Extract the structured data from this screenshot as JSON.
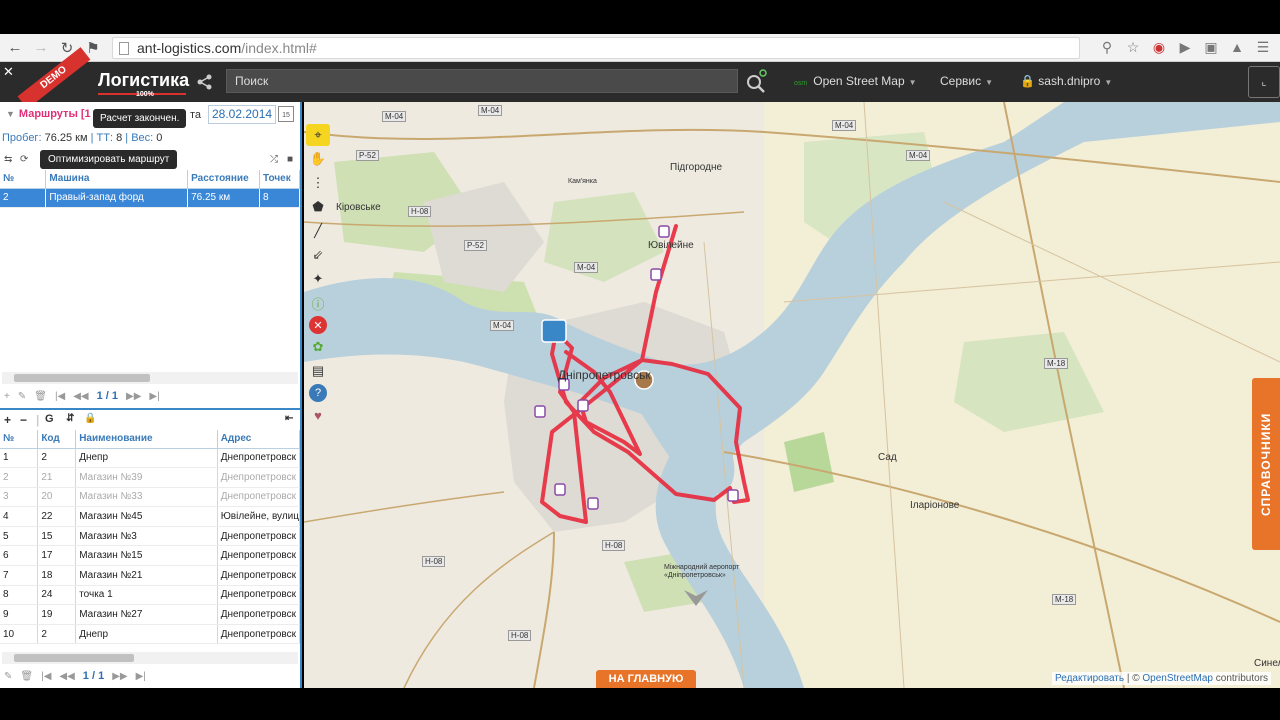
{
  "browser": {
    "url_host": "ant-logistics.com",
    "url_path": "/index.html#"
  },
  "header": {
    "demo_badge": "DEMO",
    "app_title": "Логистика",
    "progress_label": "100%",
    "search_placeholder": "Поиск",
    "map_provider": "Open Street Map",
    "map_provider_tag": "osm",
    "service_menu": "Сервис",
    "user_name": "sash.dnipro"
  },
  "routes_panel": {
    "tab_label": "Маршруты [1",
    "date_label": "та",
    "date_value": "28.02.2014",
    "tooltip_calc": "Расчет закончен.",
    "mileage_label": "Пробег:",
    "mileage_value": "76.25 км",
    "tt_label": "ТТ:",
    "tt_value": "8",
    "weight_label": "Вес:",
    "weight_value": "0",
    "tooltip_optimize": "Оптимизировать маршрут",
    "columns": [
      "№",
      "Машина",
      "Расстояние",
      "Точек"
    ],
    "rows": [
      {
        "no": "2",
        "car": "Правый-запад форд",
        "distance": "76.25 км",
        "points": "8"
      }
    ],
    "pager": "1 / 1"
  },
  "points_panel": {
    "toolbar_g": "G",
    "columns": [
      "№",
      "Код",
      "Наименование",
      "Адрес"
    ],
    "rows": [
      {
        "no": "1",
        "code": "2",
        "name": "Днепр",
        "address": "Днепропетровск",
        "muted": false
      },
      {
        "no": "2",
        "code": "21",
        "name": "Магазин №39",
        "address": "Днепропетровск",
        "muted": true
      },
      {
        "no": "3",
        "code": "20",
        "name": "Магазин №33",
        "address": "Днепропетровск",
        "muted": true
      },
      {
        "no": "4",
        "code": "22",
        "name": "Магазин №45",
        "address": "Ювілейне, вулиц",
        "muted": false
      },
      {
        "no": "5",
        "code": "15",
        "name": "Магазин №3",
        "address": "Днепропетровск",
        "muted": false
      },
      {
        "no": "6",
        "code": "17",
        "name": "Магазин №15",
        "address": "Днепропетровск",
        "muted": false
      },
      {
        "no": "7",
        "code": "18",
        "name": "Магазин №21",
        "address": "Днепропетровск",
        "muted": false
      },
      {
        "no": "8",
        "code": "24",
        "name": "точка 1",
        "address": "Днепропетровск",
        "muted": false
      },
      {
        "no": "9",
        "code": "19",
        "name": "Магазин №27",
        "address": "Днепропетровск",
        "muted": false
      },
      {
        "no": "10",
        "code": "2",
        "name": "Днепр",
        "address": "Днепропетровск",
        "muted": false
      }
    ],
    "pager": "1 / 1"
  },
  "map": {
    "labels": {
      "pidgorodne": "Підгородне",
      "kirovske": "Кіровське",
      "yuvileine": "Ювілейне",
      "dnipro": "Дніпропетровськ",
      "sad": "Сад",
      "ilarionove": "Іларіонове",
      "synelnyk": "Синель",
      "kamyanka": "Кам'янка",
      "airport": "Міжнародний аеропорт «Дніпропетровськ»"
    },
    "roads": [
      "M-04",
      "M-04",
      "M-04",
      "P-52",
      "P-52",
      "M-04",
      "M-04",
      "M-04",
      "M-18",
      "H-08",
      "H-08",
      "H-08",
      "M-18",
      "H-08"
    ],
    "sprav_tab": "СПРАВОЧНИКИ",
    "home_button": "НА ГЛАВНУЮ",
    "attribution_edit": "Редактировать",
    "attribution_sep": " | © ",
    "attribution_osm": "OpenStreetMap",
    "attribution_contrib": " contributors",
    "route_color": "#e8283c",
    "icons": [
      "locate-icon",
      "hand-icon",
      "points-icon",
      "polygon-icon",
      "line-icon",
      "arrow-icon",
      "magic-icon",
      "info-icon",
      "delete-icon",
      "leaf-icon",
      "film-icon",
      "help-icon",
      "bag-icon"
    ]
  }
}
